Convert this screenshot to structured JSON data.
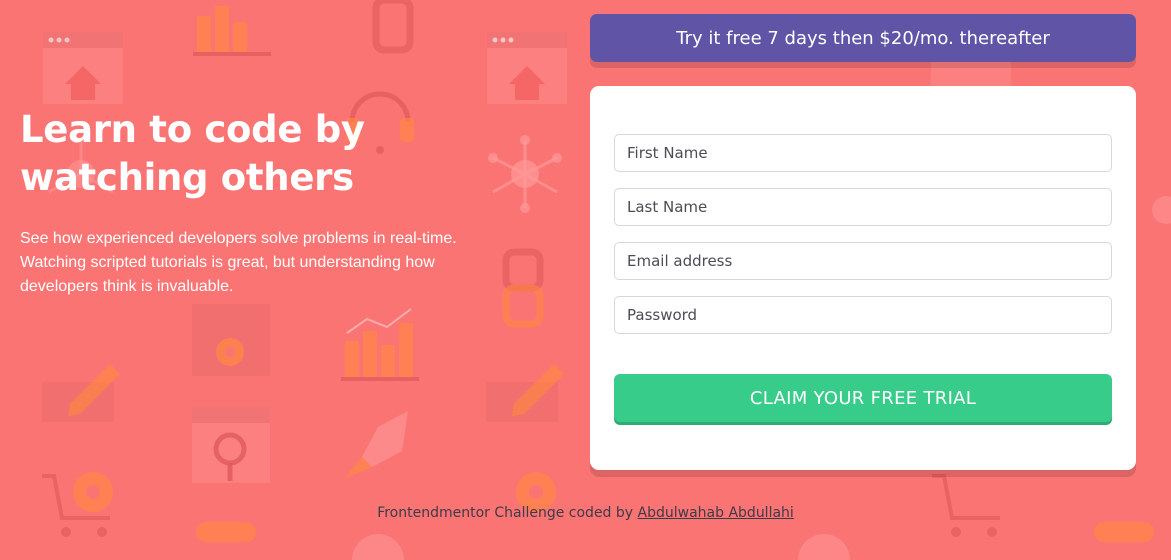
{
  "colors": {
    "background": "#fa7474",
    "promo": "#5f54a6",
    "card": "#ffffff",
    "button": "#38cc8b",
    "text_dark": "#3d3b48"
  },
  "hero": {
    "title_line1": "Learn to code by",
    "title_line2": "watching others",
    "description": "See how experienced developers solve problems in real-time. Watching scripted tutorials is great, but understanding how developers think is invaluable."
  },
  "promo": {
    "text": "Try it free 7 days then $20/mo. thereafter"
  },
  "form": {
    "first_name_placeholder": "First Name",
    "last_name_placeholder": "Last Name",
    "email_placeholder": "Email address",
    "password_placeholder": "Password",
    "submit_label": "CLAIM YOUR FREE TRIAL"
  },
  "footer": {
    "prefix": "Frontendmentor Challenge coded by ",
    "author": "Abdulwahab Abdullahi"
  },
  "background_icons": [
    "browser-window-icon",
    "bar-chart-icon",
    "headset-icon",
    "network-icon",
    "chain-link-icon",
    "gear-icon",
    "pencil-icon",
    "magnifier-icon",
    "rocket-icon",
    "shopping-cart-icon",
    "key-icon",
    "globe-icon"
  ]
}
